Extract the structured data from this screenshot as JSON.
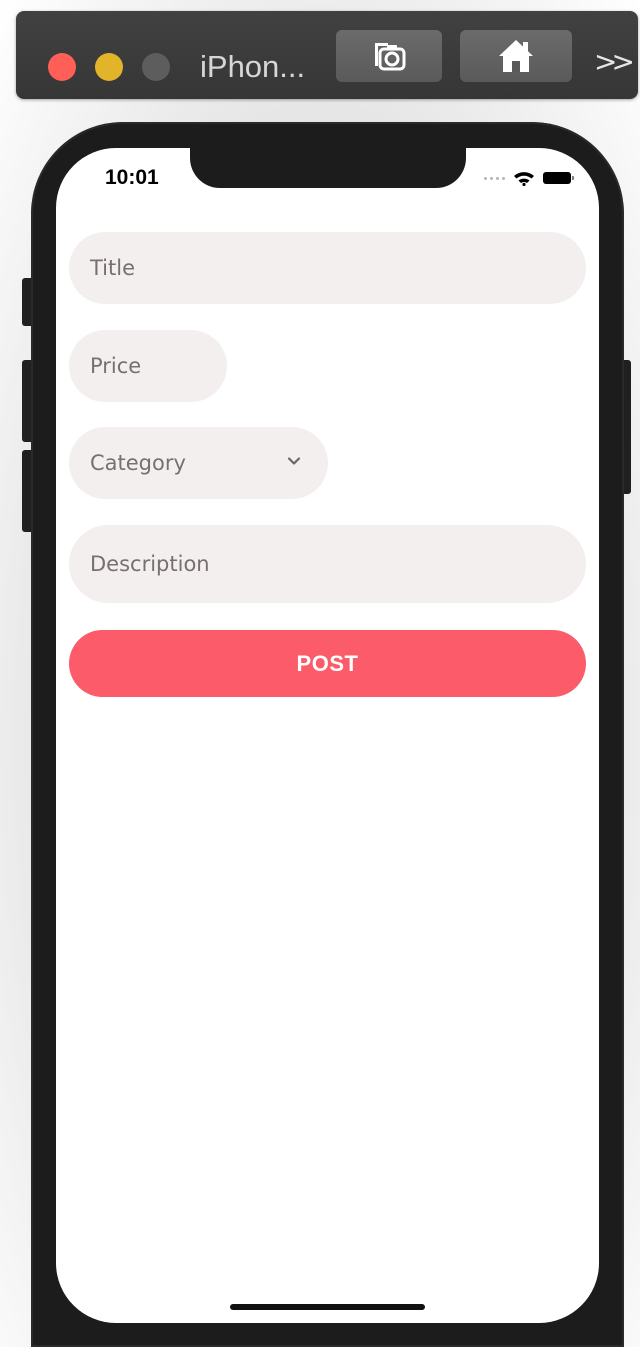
{
  "window": {
    "device_name": "iPhon...",
    "toolbar_icons": [
      "screenshot-icon",
      "home-icon",
      "more-icon"
    ],
    "traffic_light_colors": {
      "close": "#ff5f57",
      "minimize": "#e1b42a",
      "zoom": "#5d5d5d"
    }
  },
  "status_bar": {
    "time": "10:01",
    "icons": [
      "signal-icon",
      "wifi-icon",
      "battery-icon"
    ]
  },
  "form": {
    "title_placeholder": "Title",
    "price_placeholder": "Price",
    "category_placeholder": "Category",
    "description_placeholder": "Description",
    "post_label": "POST"
  },
  "colors": {
    "accent": "#fc5b6a",
    "field_background": "#f4efef",
    "placeholder_text": "#787070"
  }
}
